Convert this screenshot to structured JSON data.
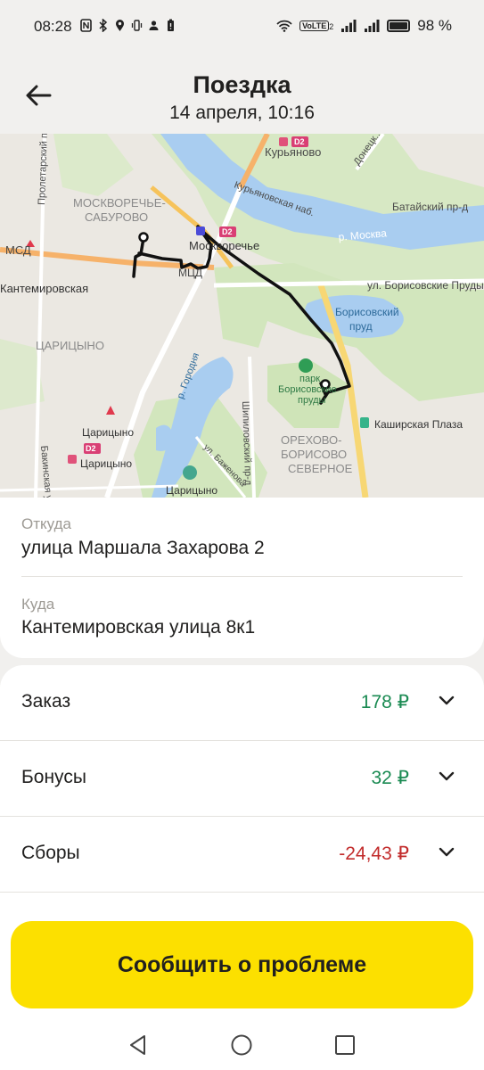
{
  "status_bar": {
    "time": "08:28",
    "battery_percent": "98 %",
    "volte": "VoLTE",
    "volte_sub": "2"
  },
  "header": {
    "title": "Поездка",
    "subtitle": "14 апреля, 10:16",
    "back_icon": "arrow-left-icon"
  },
  "map": {
    "labels": {
      "kuryanovo": "Курьяново",
      "proletarsky": "Пролетарский пр-т",
      "moskvorechye_1": "МОСКВОРЕЧЬЕ-",
      "moskvorechye_2": "САБУРОВО",
      "kuryanovskaya": "Курьяновская наб.",
      "batayskiy": "Батайский пр-д",
      "moskva_river": "р. Москва",
      "mcd": "МСД",
      "moskvorechye_station": "Москворечье",
      "d2": "D2",
      "mcd_2": "МЦД",
      "kantemirovskaya": "Кантемировская",
      "borisovskie": "ул. Борисовские Пруды",
      "borisovsky_1": "Борисовский",
      "borisovsky_2": "пруд",
      "tsaritsyno_district": "ЦАРИЦЫНО",
      "gorodnya": "р. Городня",
      "park_1": "парк",
      "park_2": "Борисовские",
      "park_3": "пруды",
      "bakinskaya": "Бакинская ул.",
      "tsaritsyno_m": "Царицыно",
      "tsaritsyno_d2": "Царицыно",
      "shipilovsky": "Шипиловский пр-д",
      "kashirskaya_plaza": "Каширская Плаза",
      "orekhovo_1": "ОРЕХОВО-",
      "orekhovo_2": "БОРИСОВО",
      "orekhovo_3": "СЕВЕРНОЕ",
      "bazhenova": "ул. Баженова",
      "tsaritsyno_museum": "Царицыно",
      "donetskaya": "Донецк..."
    }
  },
  "addresses": {
    "from_label": "Откуда",
    "from_value": "улица Маршала Захарова 2",
    "to_label": "Куда",
    "to_value": "Кантемировская улица 8к1"
  },
  "payment": {
    "rows": [
      {
        "label": "Заказ",
        "amount": "178 ₽",
        "color": "#1a8a52"
      },
      {
        "label": "Бонусы",
        "amount": "32 ₽",
        "color": "#1a8a52"
      },
      {
        "label": "Сборы",
        "amount": "-24,43 ₽",
        "color": "#c22b2b"
      }
    ]
  },
  "actions": {
    "report_button": "Сообщить о проблеме",
    "accent_color": "#fce000"
  },
  "nav": {
    "back": "triangle-back-icon",
    "home": "circle-home-icon",
    "recents": "square-recents-icon"
  }
}
